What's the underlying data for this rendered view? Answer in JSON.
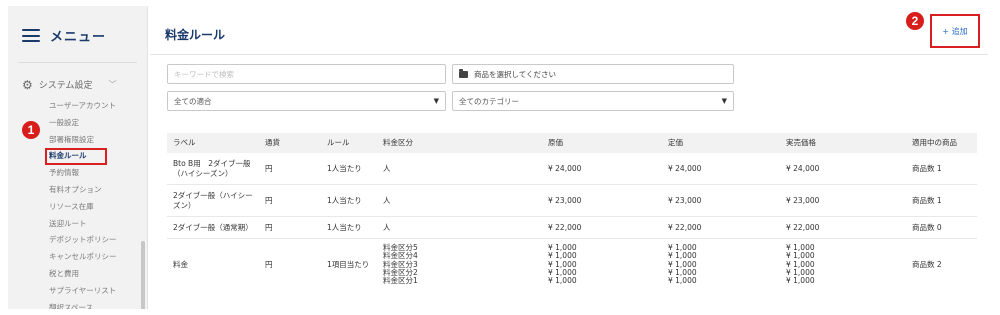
{
  "sidebar": {
    "menu_title": "メニュー",
    "system_settings": "システム設定",
    "items": [
      {
        "label": "ユーザーアカウント",
        "active": false
      },
      {
        "label": "一般設定",
        "active": false
      },
      {
        "label": "部署権限設定",
        "active": false
      },
      {
        "label": "料金ルール",
        "active": true
      },
      {
        "label": "予約情報",
        "active": false
      },
      {
        "label": "有料オプション",
        "active": false
      },
      {
        "label": "リソース在庫",
        "active": false
      },
      {
        "label": "送迎ルート",
        "active": false
      },
      {
        "label": "デポジットポリシー",
        "active": false
      },
      {
        "label": "キャンセルポリシー",
        "active": false
      },
      {
        "label": "税と費用",
        "active": false
      },
      {
        "label": "サプライヤーリスト",
        "active": false
      },
      {
        "label": "翻訳スペース",
        "active": false
      }
    ]
  },
  "annotations": {
    "badge1": "1",
    "badge2": "2"
  },
  "main": {
    "title": "料金ルール",
    "add_label": "+ 追加"
  },
  "filters": {
    "keyword_placeholder": "キーワードで検索",
    "product_select": "商品を選択してください",
    "store_select": "全ての適合",
    "category_select": "全てのカテゴリー"
  },
  "table": {
    "headers": {
      "label": "ラベル",
      "currency": "通貨",
      "rule": "ルール",
      "tier": "料金区分",
      "cost": "原価",
      "list": "定価",
      "sale": "実売価格",
      "products": "適用中の商品"
    },
    "rows": [
      {
        "label": "Bto B用　2ダイブ一般（ハイシーズン）",
        "currency": "円",
        "rule": "1人当たり",
        "tier": "人",
        "cost": "¥ 24,000",
        "list": "¥ 24,000",
        "sale": "¥ 24,000",
        "products": "商品数 1"
      },
      {
        "label": "2ダイブ一般（ハイシーズン）",
        "currency": "円",
        "rule": "1人当たり",
        "tier": "人",
        "cost": "¥ 23,000",
        "list": "¥ 23,000",
        "sale": "¥ 23,000",
        "products": "商品数 1"
      },
      {
        "label": "2ダイブ一般（通常期）",
        "currency": "円",
        "rule": "1人当たり",
        "tier": "人",
        "cost": "¥ 22,000",
        "list": "¥ 22,000",
        "sale": "¥ 22,000",
        "products": "商品数 0"
      },
      {
        "label": "料金",
        "currency": "円",
        "rule": "1項目当たり",
        "tiers": [
          "料金区分5",
          "料金区分4",
          "料金区分3",
          "料金区分2",
          "料金区分1"
        ],
        "costs": [
          "¥ 1,000",
          "¥ 1,000",
          "¥ 1,000",
          "¥ 1,000",
          "¥ 1,000"
        ],
        "lists": [
          "¥ 1,000",
          "¥ 1,000",
          "¥ 1,000",
          "¥ 1,000",
          "¥ 1,000"
        ],
        "sales": [
          "¥ 1,000",
          "¥ 1,000",
          "¥ 1,000",
          "¥ 1,000",
          "¥ 1,000"
        ],
        "products": "商品数 2"
      }
    ]
  }
}
